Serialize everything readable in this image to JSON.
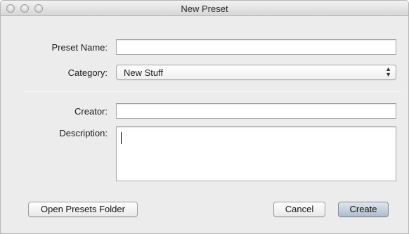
{
  "window": {
    "title": "New Preset"
  },
  "form": {
    "preset_name_label": "Preset Name:",
    "preset_name_value": "",
    "category_label": "Category:",
    "category_value": "New Stuff",
    "creator_label": "Creator:",
    "creator_value": "",
    "description_label": "Description:",
    "description_value": ""
  },
  "buttons": {
    "open_folder": "Open Presets Folder",
    "cancel": "Cancel",
    "create": "Create"
  },
  "icons": {
    "select_arrows": "up-down-chevron-icon"
  }
}
